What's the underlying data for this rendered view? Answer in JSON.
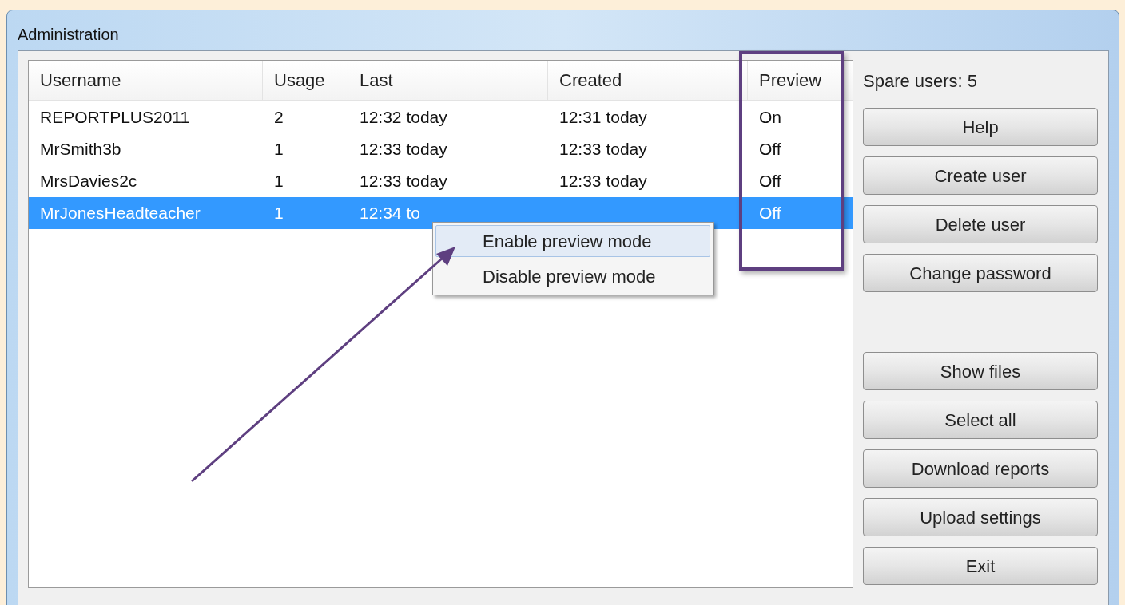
{
  "window": {
    "title": "Administration"
  },
  "table": {
    "columns": [
      "Username",
      "Usage",
      "Last",
      "Created",
      "Preview"
    ],
    "rows": [
      {
        "username": "REPORTPLUS2011",
        "usage": "2",
        "last": "12:32 today",
        "created": "12:31 today",
        "preview": "On",
        "selected": false
      },
      {
        "username": "MrSmith3b",
        "usage": "1",
        "last": "12:33 today",
        "created": "12:33 today",
        "preview": "Off",
        "selected": false
      },
      {
        "username": "MrsDavies2c",
        "usage": "1",
        "last": "12:33 today",
        "created": "12:33 today",
        "preview": "Off",
        "selected": false
      },
      {
        "username": "MrJonesHeadteacher",
        "usage": "1",
        "last": "12:34 to",
        "preview": "Off",
        "selected": true
      }
    ]
  },
  "context_menu": {
    "items": [
      {
        "label": "Enable preview mode",
        "selected": true
      },
      {
        "label": "Disable preview mode",
        "selected": false
      }
    ]
  },
  "side_panel": {
    "spare_users": "Spare users: 5",
    "top_buttons": [
      "Help",
      "Create user",
      "Delete user",
      "Change password"
    ],
    "bottom_buttons": [
      "Show files",
      "Select all",
      "Download reports",
      "Upload settings",
      "Exit"
    ]
  }
}
